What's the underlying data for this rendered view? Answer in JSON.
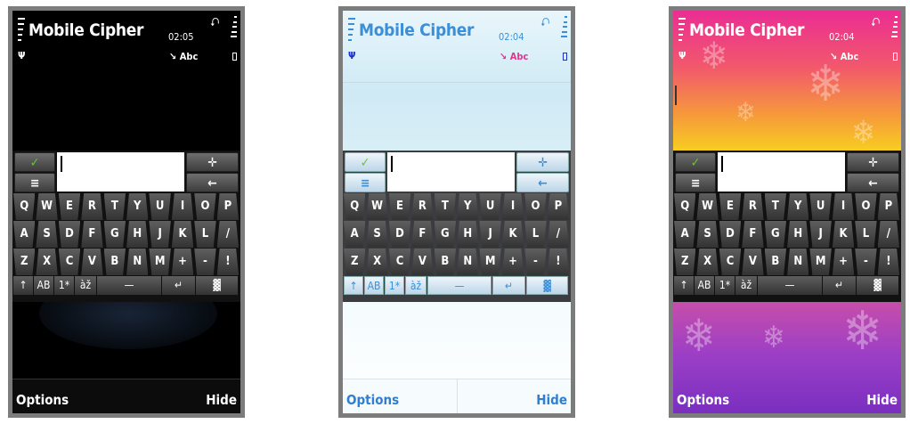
{
  "status": {
    "app_title": "Mobile Cipher",
    "input_mode": "↘ Abc",
    "usb_icon": "usb-icon",
    "antenna_icon": "antenna-icon"
  },
  "phones": [
    {
      "theme": "dark",
      "time": "02:05"
    },
    {
      "theme": "light-blue",
      "time": "02:04"
    },
    {
      "theme": "snowflake-gradient",
      "time": "02:04"
    }
  ],
  "keyboard": {
    "ok_icon": "✓",
    "menu_icon": "≡",
    "move_icon": "✛",
    "backspace_icon": "←",
    "rows": [
      [
        "Q",
        "W",
        "E",
        "R",
        "T",
        "Y",
        "U",
        "I",
        "O",
        "P"
      ],
      [
        "A",
        "S",
        "D",
        "F",
        "G",
        "H",
        "J",
        "K",
        "L",
        "/"
      ],
      [
        "Z",
        "X",
        "C",
        "V",
        "B",
        "N",
        "M",
        "+",
        "-",
        "!"
      ]
    ],
    "bottom": {
      "shift": "↑",
      "case": "AB",
      "numbers": "1*",
      "accents": "àž",
      "space": "—",
      "enter": "↵",
      "layout": "▓"
    }
  },
  "softkeys": {
    "left": "Options",
    "right": "Hide"
  }
}
